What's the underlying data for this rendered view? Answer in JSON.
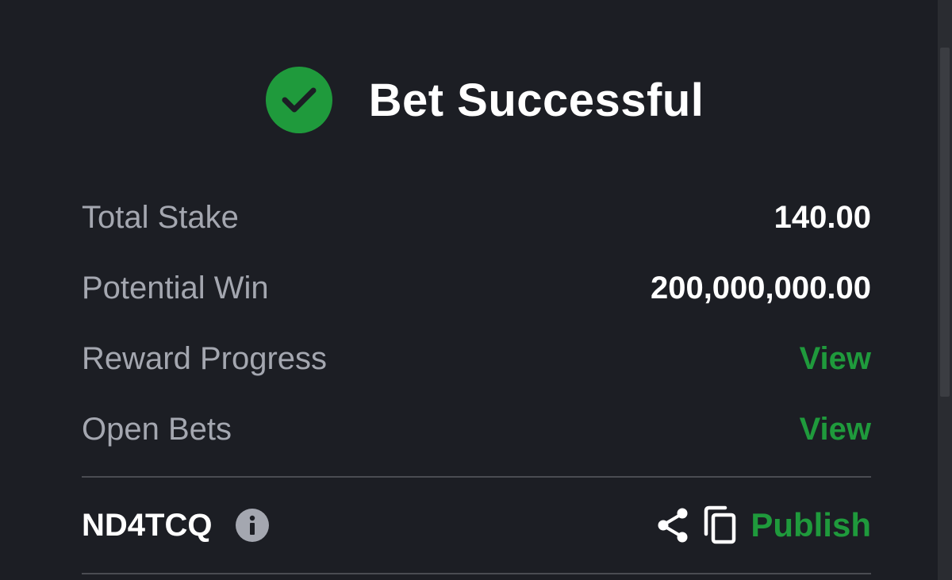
{
  "header": {
    "title": "Bet Successful",
    "icon": "check-circle-icon",
    "icon_color": "#1f9a3c"
  },
  "summary": {
    "rows": [
      {
        "label": "Total Stake",
        "value": "140.00"
      },
      {
        "label": "Potential Win",
        "value": "200,000,000.00"
      },
      {
        "label": "Reward Progress",
        "value": "View"
      },
      {
        "label": "Open Bets",
        "value": "View"
      }
    ]
  },
  "footer": {
    "booking_code": "ND4TCQ",
    "info_icon": "info-icon",
    "share_icon": "share-icon",
    "copy_icon": "copy-icon",
    "publish_label": "Publish"
  },
  "colors": {
    "background": "#1c1e24",
    "accent": "#1f9a3c",
    "label": "#a4a7b0",
    "value": "#ffffff"
  }
}
